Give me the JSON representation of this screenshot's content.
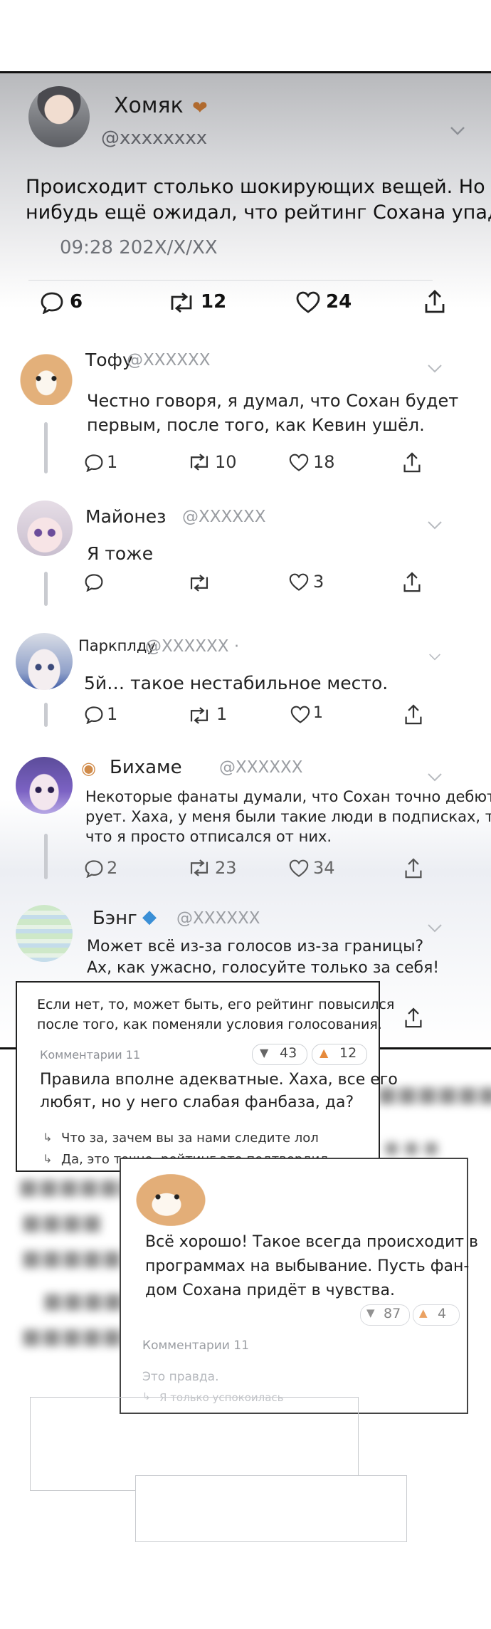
{
  "main_post": {
    "display_name": "Хомяк",
    "handle": "@xxxxxxxx",
    "text_line1": "Происходит столько шокирующих вещей. Но кто-",
    "text_line2": "нибудь ещё ожидал, что рейтинг Сохана упадёт?",
    "timestamp": "09:28 202X/X/XX",
    "replies": "6",
    "retweets": "12",
    "likes": "24"
  },
  "replies": [
    {
      "name": "Тофу",
      "handle": "@XXXXXX",
      "line1": "Честно говоря, я думал, что Сохан будет",
      "line2": "первым, после того, как Кевин ушёл.",
      "line3": "",
      "replies": "1",
      "retweets": "10",
      "likes": "18"
    },
    {
      "name": "Майонез",
      "handle": "@XXXXXX",
      "line1": "Я тоже",
      "line2": "",
      "line3": "",
      "replies": "",
      "retweets": "",
      "likes": "3"
    },
    {
      "name": "Паркплду",
      "handle": "@XXXXXX ·",
      "line1": "5й… такое нестабильное место.",
      "line2": "",
      "line3": "",
      "replies": "1",
      "retweets": "1",
      "likes": "1"
    },
    {
      "name": "Бихаме",
      "handle": "@XXXXXX",
      "line1": "Некоторые фанаты думали, что Сохан точно дебюти-",
      "line2": "рует. Хаха, у меня были такие люди в подписках, так",
      "line3": "что я просто отписался от них.",
      "replies": "2",
      "retweets": "23",
      "likes": "34"
    },
    {
      "name": "Бэнг",
      "handle": "@XXXXXX",
      "line1": "Может всё из-за голосов из-за границы?",
      "line2": "Ах, как ужасно, голосуйте только за себя!",
      "line3": "",
      "replies": "",
      "retweets": "",
      "likes": ""
    }
  ],
  "card1": {
    "line1": "Если нет, то, может быть, его рейтинг повысился",
    "line2": "после того, как поменяли условия голосования.",
    "comments_label": "Комментарии 11",
    "dislikes": "43",
    "likes": "12",
    "reply_line1": "Правила вполне адекватные. Хаха, все его",
    "reply_line2": "любят, но у него слабая фанбаза, да?",
    "sub1": "Что за, зачем вы за нами следите лол",
    "sub2": "Да, это точно, рейтинг это подтвердил"
  },
  "card2": {
    "line1": "Всё хорошо! Такое всегда происходит в",
    "line2": "программах на выбывание. Пусть фан-",
    "line3": "дом Сохана придёт в чувства.",
    "dislikes": "87",
    "likes": "4",
    "comments_label": "Комментарии 11",
    "reply": "Это правда.",
    "sub": "Я только успокоилась"
  },
  "icons": [
    "comment-icon",
    "retweet-icon",
    "heart-icon",
    "share-icon",
    "chevron-down-icon",
    "thumbs-down-icon",
    "thumbs-up-icon",
    "heart-emoji-icon",
    "gem-icon",
    "hamster-icon"
  ]
}
